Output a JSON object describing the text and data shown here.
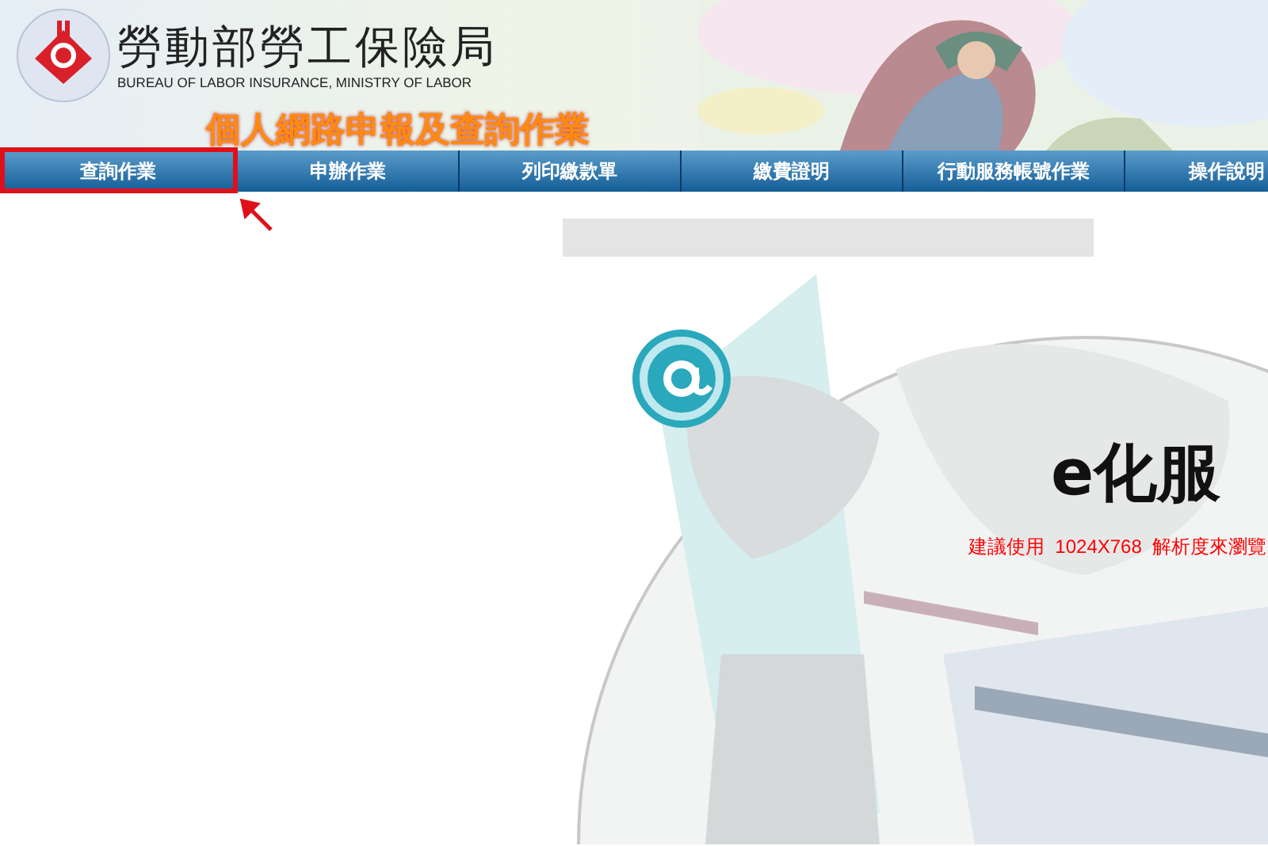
{
  "header": {
    "agency_name": "勞動部勞工保險局",
    "agency_name_en": "BUREAU OF LABOR INSURANCE, MINISTRY OF LABOR",
    "service_title": "個人網路申報及查詢作業"
  },
  "tabs": [
    {
      "label": "查詢作業",
      "highlighted": true
    },
    {
      "label": "申辦作業",
      "highlighted": false
    },
    {
      "label": "列印繳款單",
      "highlighted": false
    },
    {
      "label": "繳費證明",
      "highlighted": false
    },
    {
      "label": "行動服務帳號作業",
      "highlighted": false
    },
    {
      "label": "操作說明",
      "highlighted": false
    }
  ],
  "banner": {
    "title": "e化服",
    "notice": "建議使用  1024X768  解析度來瀏覽"
  }
}
